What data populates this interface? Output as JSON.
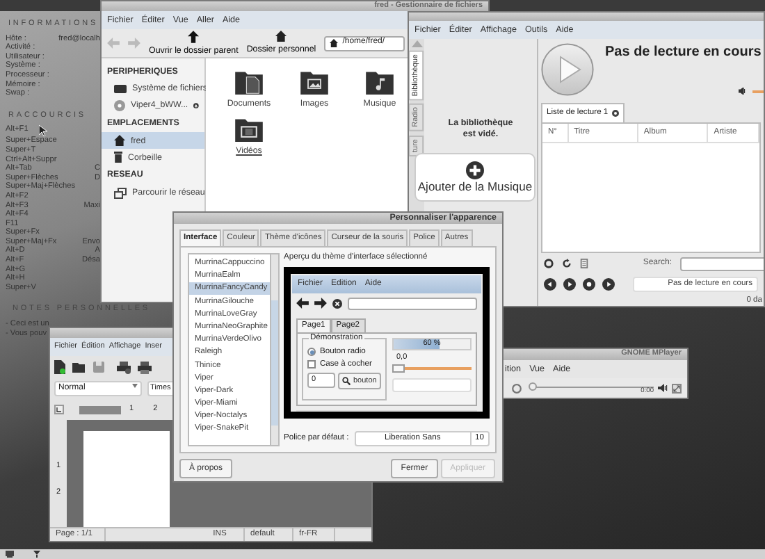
{
  "conky": {
    "informations": {
      "title": "INFORMATIONS",
      "rows": [
        {
          "label": "Hôte :",
          "value": "fred@localh"
        },
        {
          "label": "Activité :"
        },
        {
          "label": "Utilisateur :"
        },
        {
          "label": "Système :"
        },
        {
          "label": "Processeur :"
        },
        {
          "label": "Mémoire :"
        },
        {
          "label": "Swap :"
        }
      ]
    },
    "shortcuts": {
      "title": "RACCOURCIS",
      "rows": [
        {
          "key": "Alt+F1"
        },
        {
          "key": "Super+Espace"
        },
        {
          "key": "Super+T"
        },
        {
          "key": "Ctrl+Alt+Suppr"
        },
        {
          "key": "Alt+Tab",
          "action": "C"
        },
        {
          "key": "Super+Flèches",
          "action": "D"
        },
        {
          "key": "Super+Maj+Flèches"
        },
        {
          "key": "Alt+F2"
        },
        {
          "key": "Alt+F3",
          "action": "Maxi"
        },
        {
          "key": "Alt+F4"
        },
        {
          "key": "F11"
        },
        {
          "key": "Super+Fx"
        },
        {
          "key": "Super+Maj+Fx",
          "action": "Envo"
        },
        {
          "key": "Alt+D",
          "action": "A"
        },
        {
          "key": "Alt+F",
          "action": "Désa"
        },
        {
          "key": "Alt+G"
        },
        {
          "key": "Alt+H"
        },
        {
          "key": "Super+V"
        }
      ]
    },
    "notes": {
      "title": "NOTES PERSONNELLES",
      "lines": [
        "- Ceci est un",
        "- Vous pouv"
      ]
    }
  },
  "file_manager": {
    "title": "fred - Gestionnaire de fichiers",
    "menu": [
      "Fichier",
      "Éditer",
      "Vue",
      "Aller",
      "Aide"
    ],
    "toolbar": [
      {
        "label": "Ouvrir le dossier parent",
        "kind": "parent"
      },
      {
        "label": "Dossier personnel",
        "kind": "home"
      }
    ],
    "path": "/home/fred/",
    "sidebar": [
      {
        "title": "PERIPHERIQUES",
        "items": [
          {
            "label": "Système de fichiers",
            "kind": "drive",
            "selected": false
          },
          {
            "label": "Viper4_bWW...",
            "kind": "disc",
            "selected": false
          }
        ]
      },
      {
        "title": "EMPLACEMENTS",
        "items": [
          {
            "label": "fred",
            "kind": "home",
            "selected": true
          },
          {
            "label": "Corbeille",
            "kind": "trash",
            "selected": false
          }
        ]
      },
      {
        "title": "RESEAU",
        "items": [
          {
            "label": "Parcourir le réseau",
            "kind": "network",
            "selected": false
          }
        ]
      }
    ],
    "files": [
      {
        "label": "Documents",
        "kind": "documents",
        "hovered": false
      },
      {
        "label": "Images",
        "kind": "images",
        "hovered": false
      },
      {
        "label": "Musique",
        "kind": "music",
        "hovered": false
      },
      {
        "label": "Vidéos",
        "kind": "videos",
        "hovered": true
      }
    ]
  },
  "music_player": {
    "menu": [
      "Fichier",
      "Éditer",
      "Affichage",
      "Outils",
      "Aide"
    ],
    "side_tabs": [
      {
        "label": "Bibliothèque",
        "selected": true
      },
      {
        "label": "Radio",
        "selected": false
      },
      {
        "label": "ture",
        "selected": false
      }
    ],
    "library_message": "La bibliothèque est vidé.",
    "add_button": "Ajouter de la Musique",
    "now_playing": "Pas de lecture en cours",
    "playlist_tabs": [
      {
        "label": "Liste de lecture 1",
        "selected": true
      }
    ],
    "columns": [
      "N°",
      "Titre",
      "Album",
      "Artiste"
    ],
    "search_label": "Search:",
    "status": "Pas de lecture en cours",
    "footer": "0 da"
  },
  "appearance_dialog": {
    "title": "Personnaliser l'apparence",
    "tabs": [
      {
        "label": "Interface",
        "selected": true
      },
      {
        "label": "Couleur",
        "selected": false
      },
      {
        "label": "Thème d'icônes",
        "selected": false
      },
      {
        "label": "Curseur de la souris",
        "selected": false
      },
      {
        "label": "Police",
        "selected": false
      },
      {
        "label": "Autres",
        "selected": false
      }
    ],
    "themes": [
      {
        "label": "MurrinaCappuccino",
        "selected": false
      },
      {
        "label": "MurrinaEalm",
        "selected": false
      },
      {
        "label": "MurrinaFancyCandy",
        "selected": true
      },
      {
        "label": "MurrinaGilouche",
        "selected": false
      },
      {
        "label": "MurrinaLoveGray",
        "selected": false
      },
      {
        "label": "MurrinaNeoGraphite",
        "selected": false
      },
      {
        "label": "MurrinaVerdeOlivo",
        "selected": false
      },
      {
        "label": "Raleigh",
        "selected": false
      },
      {
        "label": "Thinice",
        "selected": false
      },
      {
        "label": "Viper",
        "selected": false
      },
      {
        "label": "Viper-Dark",
        "selected": false
      },
      {
        "label": "Viper-Miami",
        "selected": false
      },
      {
        "label": "Viper-Noctalys",
        "selected": false
      },
      {
        "label": "Viper-SnakePit",
        "selected": false
      }
    ],
    "preview_label": "Aperçu du thème d'interface sélectionné",
    "preview": {
      "menu": [
        "Fichier",
        "Edition",
        "Aide"
      ],
      "tabs": [
        {
          "label": "Page1",
          "selected": true
        },
        {
          "label": "Page2",
          "selected": false
        }
      ],
      "frame_title": "Démonstration",
      "radio": {
        "label": "Bouton radio",
        "selected": true
      },
      "checkbox": {
        "label": "Case à cocher",
        "checked": false
      },
      "spin_value": "0",
      "button": "bouton",
      "progress": {
        "level": 0.6,
        "reading": "60 %"
      },
      "scale": {
        "reading": "0,0",
        "level": 0
      }
    },
    "font_label": "Police par défaut :",
    "font_name": "Liberation Sans",
    "font_size": "10",
    "buttons": [
      {
        "label": "À propos",
        "disabled": false
      },
      {
        "label": "Fermer",
        "disabled": false
      },
      {
        "label": "Appliquer",
        "disabled": true
      }
    ]
  },
  "abiword": {
    "menu": [
      "Fichier",
      "Édition",
      "Affichage",
      "Inser"
    ],
    "style": "Normal",
    "font": "Times",
    "ruler": [
      "1",
      "2"
    ],
    "vruler": [
      "1",
      "2"
    ],
    "status": [
      "Page : 1/1",
      "INS",
      "default",
      "fr-FR"
    ]
  },
  "mplayer": {
    "title": "GNOME MPlayer",
    "menu": [
      "ition",
      "Vue",
      "Aide"
    ],
    "time": "0:00",
    "seek": {
      "level": 0
    }
  }
}
